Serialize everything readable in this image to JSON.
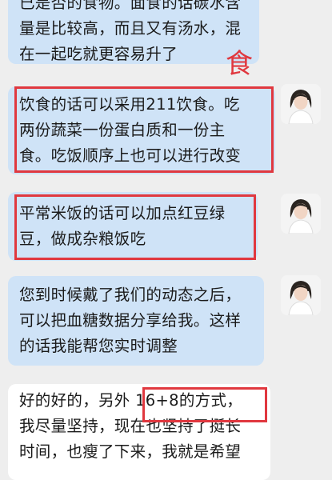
{
  "messages": [
    {
      "lines": [
        "已是否的食物。面食的话碳水含",
        "量是比较高，而且又有汤水，混",
        "在一起吃就更容易升了"
      ]
    },
    {
      "lines": [
        "饮食的话可以采用211饮食。吃",
        "两份蔬菜一份蛋白质和一份主",
        "食。吃饭顺序上也可以进行改变"
      ]
    },
    {
      "lines": [
        "平常米饭的话可以加点红豆绿",
        "豆，做成杂粮饭吃"
      ]
    },
    {
      "lines": [
        "您到时候戴了我们的动态之后，",
        "可以把血糖数据分享给我。这样",
        "的话我能帮您实时调整"
      ]
    },
    {
      "lines": [
        "好的好的，另外  16+8的方式，",
        "我尽量坚持，现在也坚持了挺长",
        "时间，也瘦了下来，我就是希望"
      ]
    }
  ],
  "annotation": {
    "text": "食"
  },
  "avatar": {
    "icon": "woman-portrait-icon"
  },
  "colors": {
    "agent_bubble": "#cfe3f7",
    "user_bubble": "#ffffff",
    "highlight": "#e0383f",
    "background": "#eeeeee"
  }
}
